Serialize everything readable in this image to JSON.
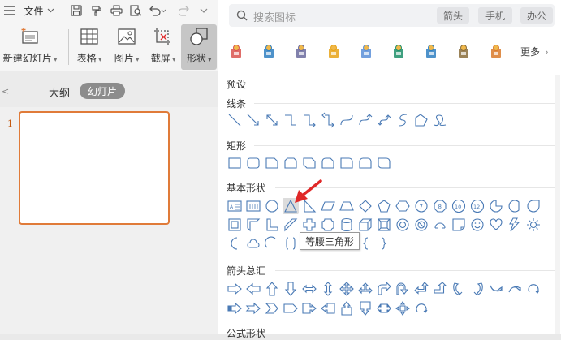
{
  "menubar": {
    "file_label": "文件"
  },
  "ribbon": {
    "new_slide": "新建幻灯片",
    "table": "表格",
    "picture": "图片",
    "screenshot": "截屏",
    "shape": "形状"
  },
  "view_tabs": {
    "outline": "大纲",
    "slides": "幻灯片"
  },
  "slides": {
    "number": "1"
  },
  "search": {
    "placeholder": "搜索图标",
    "chips": [
      "箭头",
      "手机",
      "办公"
    ]
  },
  "more_label": "更多",
  "sections": {
    "preset": "预设",
    "lines": "线条",
    "rect": "矩形",
    "basic": "基本形状",
    "arrows": "箭头总汇",
    "formula": "公式形状"
  },
  "tooltip": "等腰三角形",
  "colors": {
    "accent": "#e07b39",
    "shape_stroke": "#4a7ab5",
    "arrow_red": "#e02828"
  },
  "icons": {
    "premium_icons": [
      "stamp-icon",
      "house-icon",
      "network-icon",
      "lock-icon",
      "hub-icon",
      "presentation-icon",
      "team-icon",
      "rocket-icon",
      "box-icon"
    ]
  }
}
